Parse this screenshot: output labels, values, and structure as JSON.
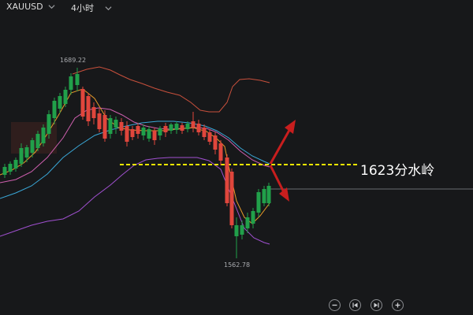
{
  "toolbar": {
    "symbol": "XAUUSD",
    "timeframe": "4小时"
  },
  "annotations": {
    "high_label": "1689.22",
    "low_label": "1562.78",
    "level_callout": "1623分水岭"
  },
  "colors": {
    "background": "#17181a",
    "up_candle": "#21a04a",
    "down_candle": "#e0463c",
    "ma_fast": "#e69a2a",
    "ma_slow": "#3aa8d8",
    "boll_upper": "#c8503c",
    "boll_lower": "#a050d0",
    "boll_mid": "#d060b0",
    "level_line": "#f2e600",
    "arrow": "#c81e1e"
  },
  "controls": [
    {
      "name": "zoom-out-icon"
    },
    {
      "name": "step-back-icon"
    },
    {
      "name": "step-forward-icon"
    },
    {
      "name": "zoom-in-icon"
    }
  ]
}
